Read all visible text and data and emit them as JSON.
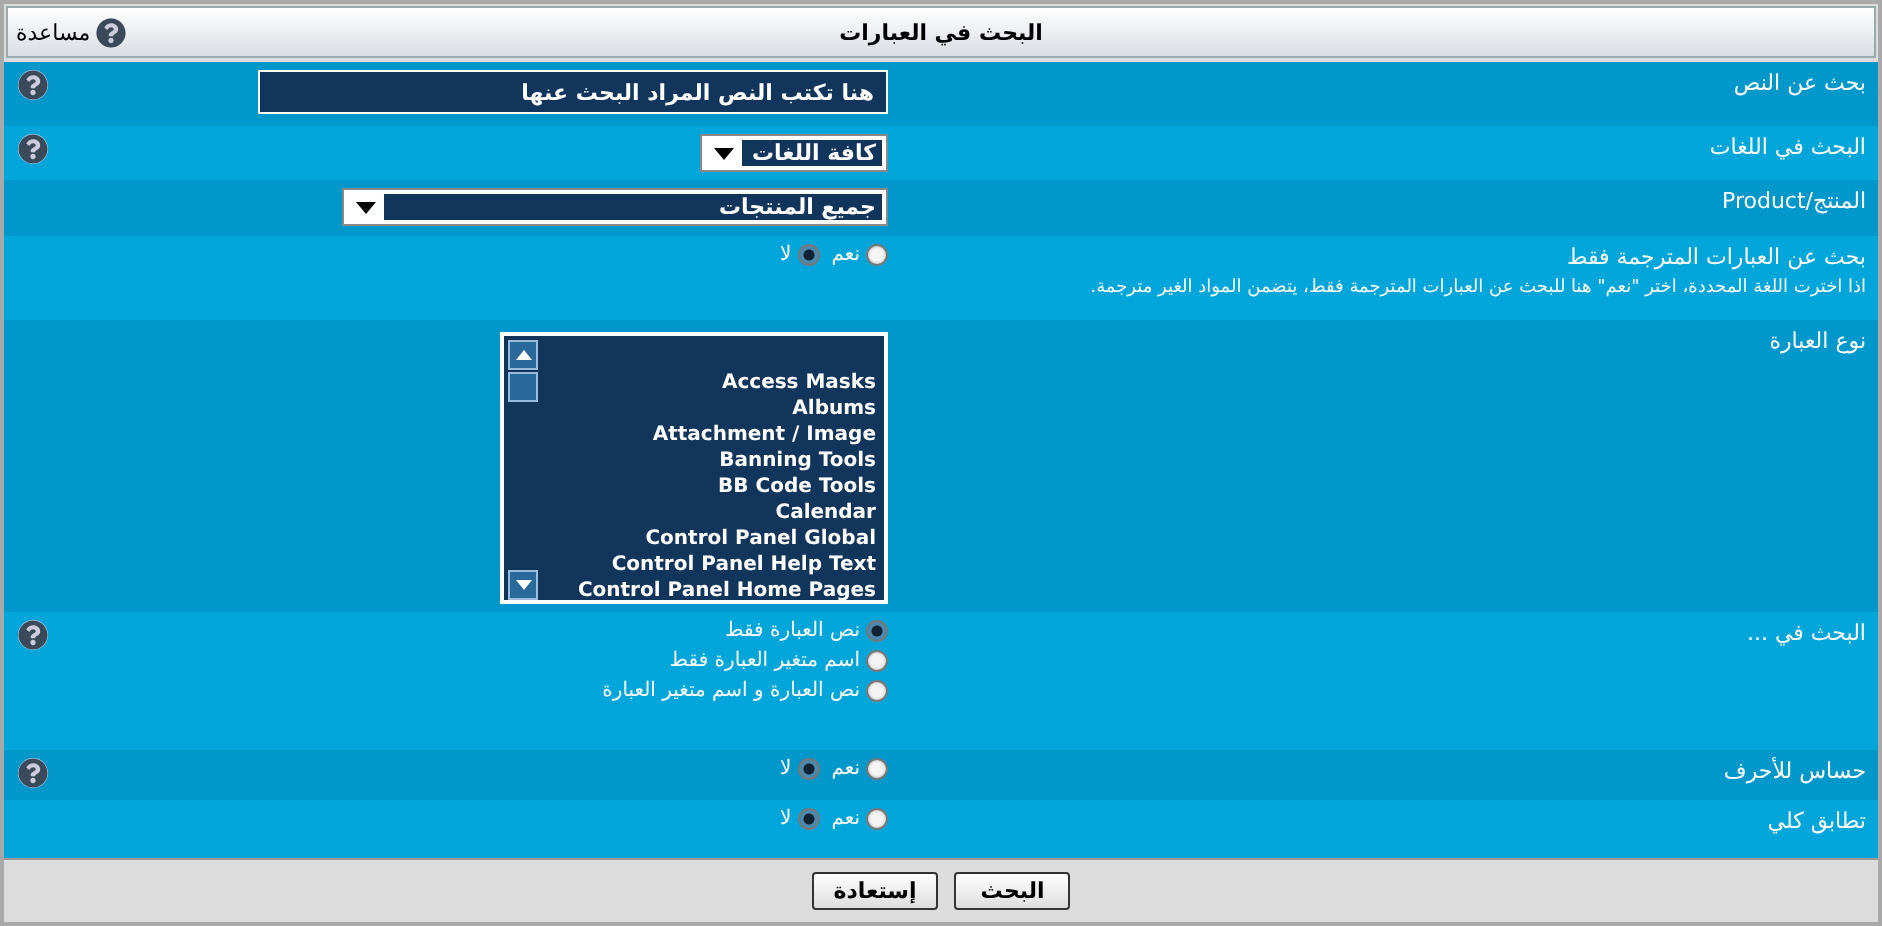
{
  "window": {
    "title": "البحث في العبارات",
    "help_link": "مساعدة"
  },
  "rows": [
    {
      "kind": "text",
      "label": "بحث عن النص",
      "value": "هنا تكتب النص المراد البحث عنها",
      "help": true
    },
    {
      "kind": "select",
      "label": "البحث في اللغات",
      "value": "كافة اللغات",
      "help": true
    },
    {
      "kind": "select",
      "label": "المنتج/Product",
      "value": "جميع المنتجات",
      "help": false
    },
    {
      "kind": "yesno",
      "label": "بحث عن العبارات المترجمة فقط",
      "note": "اذا اخترت اللغة المحددة، اختر \"نعم\" هنا للبحث عن العبارات المترجمة فقط، يتضمن المواد الغير مترجمة.",
      "help": false,
      "options": [
        {
          "label": "نعم",
          "selected": false
        },
        {
          "label": "لا",
          "selected": true
        }
      ]
    },
    {
      "kind": "list",
      "label": "نوع العبارة",
      "help": false,
      "items": [
        "Access Masks",
        "Albums",
        "Attachment / Image",
        "Banning Tools",
        "BB Code Tools",
        "Calendar",
        "Control Panel Global",
        "Control Panel Help Text",
        "Control Panel Home Pages"
      ]
    },
    {
      "kind": "radios",
      "label": "البحث في ...",
      "help": true,
      "options": [
        {
          "label": "نص العبارة فقط",
          "selected": true
        },
        {
          "label": "اسم متغير العبارة فقط",
          "selected": false
        },
        {
          "label": "نص العبارة و اسم متغير العبارة",
          "selected": false
        }
      ]
    },
    {
      "kind": "yesno",
      "label": "حساس للأحرف",
      "help": true,
      "options": [
        {
          "label": "نعم",
          "selected": false
        },
        {
          "label": "لا",
          "selected": true
        }
      ]
    },
    {
      "kind": "yesno",
      "label": "تطابق كلي",
      "help": false,
      "options": [
        {
          "label": "نعم",
          "selected": false
        },
        {
          "label": "لا",
          "selected": true
        }
      ]
    }
  ],
  "buttons": [
    "البحث",
    "إستعادة"
  ]
}
